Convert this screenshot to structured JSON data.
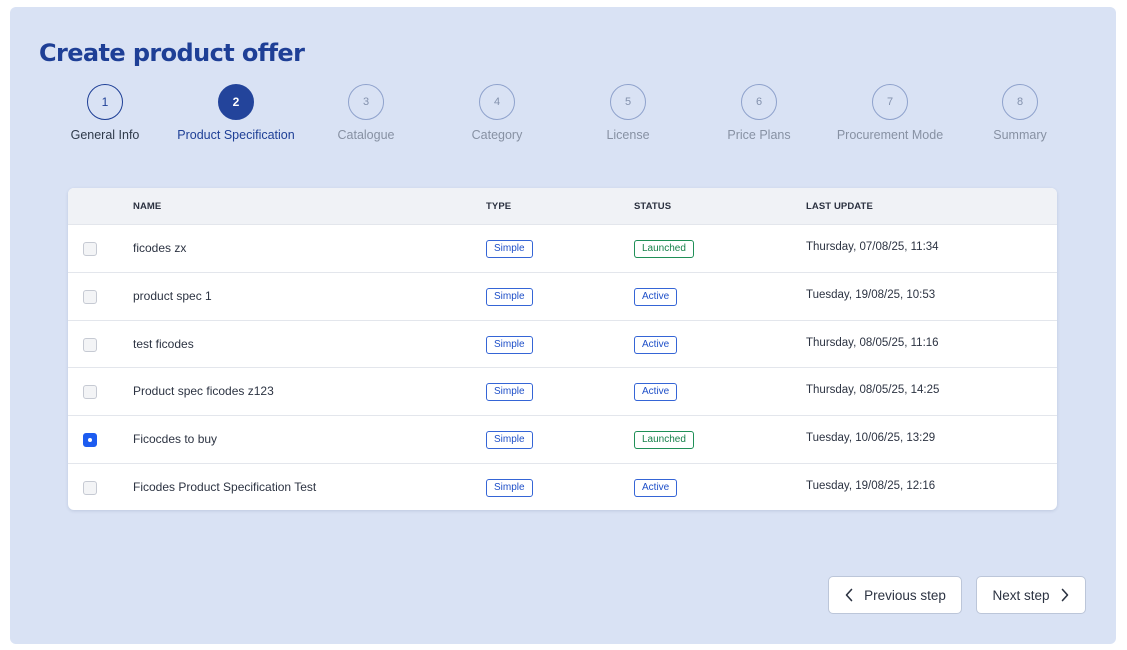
{
  "page": {
    "title": "Create product offer"
  },
  "steps": [
    {
      "num": "1",
      "label": "General Info",
      "state": "done"
    },
    {
      "num": "2",
      "label": "Product Specification",
      "state": "active"
    },
    {
      "num": "3",
      "label": "Catalogue",
      "state": "pending"
    },
    {
      "num": "4",
      "label": "Category",
      "state": "pending"
    },
    {
      "num": "5",
      "label": "License",
      "state": "pending"
    },
    {
      "num": "6",
      "label": "Price Plans",
      "state": "pending"
    },
    {
      "num": "7",
      "label": "Procurement Mode",
      "state": "pending"
    },
    {
      "num": "8",
      "label": "Summary",
      "state": "pending"
    }
  ],
  "table": {
    "columns": {
      "name": "NAME",
      "type": "TYPE",
      "status": "STATUS",
      "last_update": "LAST UPDATE"
    },
    "rows": [
      {
        "selected": false,
        "name": "ficodes zx",
        "type": "Simple",
        "status": "Launched",
        "last_update": "Thursday, 07/08/25, 11:34"
      },
      {
        "selected": false,
        "name": "product spec 1",
        "type": "Simple",
        "status": "Active",
        "last_update": "Tuesday, 19/08/25, 10:53"
      },
      {
        "selected": false,
        "name": "test ficodes",
        "type": "Simple",
        "status": "Active",
        "last_update": "Thursday, 08/05/25, 11:16"
      },
      {
        "selected": false,
        "name": "Product spec ficodes z123",
        "type": "Simple",
        "status": "Active",
        "last_update": "Thursday, 08/05/25, 14:25"
      },
      {
        "selected": true,
        "name": "Ficocdes to buy",
        "type": "Simple",
        "status": "Launched",
        "last_update": "Tuesday, 10/06/25, 13:29"
      },
      {
        "selected": false,
        "name": "Ficodes Product Specification Test",
        "type": "Simple",
        "status": "Active",
        "last_update": "Tuesday, 19/08/25, 12:16"
      }
    ]
  },
  "footer": {
    "previous_label": "Previous step",
    "next_label": "Next step"
  },
  "icons": {
    "previous": "chevron-left-icon",
    "next": "chevron-right-icon"
  },
  "colors": {
    "accent": "#1e3f96",
    "panel_bg": "#d9e2f4",
    "active_badge": "#3565d6",
    "launched_badge": "#1f8f57",
    "checkbox_selected": "#1d5cf0"
  }
}
